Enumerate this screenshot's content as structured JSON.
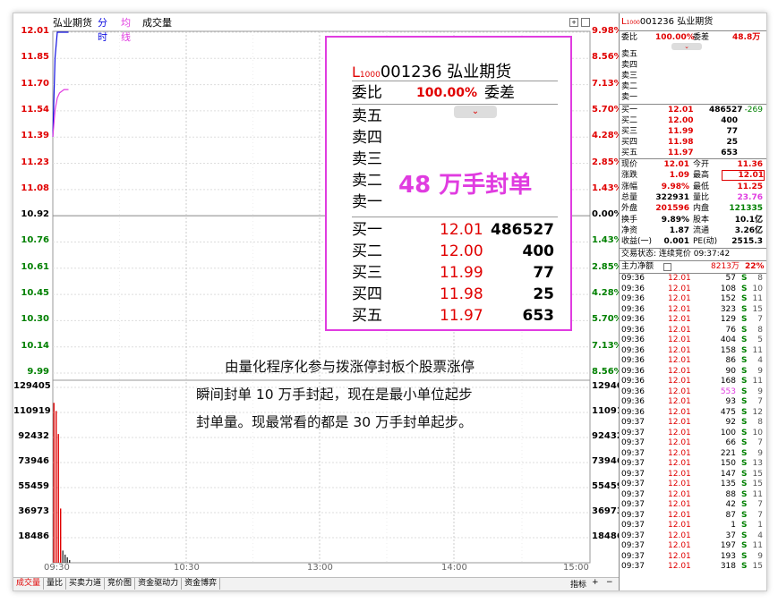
{
  "chart": {
    "stock_name": "弘业期货",
    "tab_intraday": "分时",
    "tab_avg": "均线",
    "tab_volume": "成交量",
    "price_ticks": [
      "12.01",
      "11.85",
      "11.70",
      "11.54",
      "11.39",
      "11.23",
      "11.08",
      "10.92",
      "10.76",
      "10.61",
      "10.45",
      "10.30",
      "10.14",
      "9.99"
    ],
    "pct_ticks": [
      "9.98%",
      "8.56%",
      "7.13%",
      "5.70%",
      "4.28%",
      "2.85%",
      "1.43%",
      "0.00%",
      "1.43%",
      "2.85%",
      "4.28%",
      "5.70%",
      "7.13%",
      "8.56%"
    ],
    "vol_ticks": [
      "129405",
      "110919",
      "92432",
      "73946",
      "55459",
      "36973",
      "18486"
    ],
    "time_ticks": [
      "09:30",
      "10:30",
      "13:00",
      "14:00",
      "15:00"
    ],
    "colors": {
      "up": "#e00000",
      "down": "#008000",
      "price_line": "#1010e0",
      "avg_line": "#e03ce0"
    }
  },
  "chart_data": {
    "type": "line",
    "x": [
      "09:30",
      "09:31",
      "09:32",
      "09:33",
      "09:34",
      "09:35",
      "09:36",
      "09:37"
    ],
    "series": [
      {
        "name": "分时",
        "values": [
          11.39,
          11.86,
          12.01,
          12.01,
          12.01,
          12.01,
          12.01,
          12.01
        ]
      },
      {
        "name": "均线",
        "values": [
          11.39,
          11.55,
          11.62,
          11.65,
          11.66,
          11.67,
          11.67,
          11.67
        ]
      }
    ],
    "volume": [
      118000,
      112000,
      95000,
      40000,
      9000,
      6000,
      4000,
      2000
    ],
    "ylim": [
      9.99,
      12.01
    ],
    "vol_ylim": [
      0,
      129405
    ]
  },
  "bottom_tabs": [
    "成交量",
    "量比",
    "买卖力道",
    "竞价图",
    "资金驱动力",
    "资金博弈"
  ],
  "bottom_right": {
    "index_label": "指标",
    "plus": "+",
    "minus": "−"
  },
  "quote": {
    "code_prefix": "L",
    "code_sub": "1000",
    "code": "001236",
    "name": "弘业期货",
    "weibi_label": "委比",
    "weibi_value": "100.00%",
    "weicha_label": "委差",
    "weicha_value": "48.8万",
    "sell_labels": [
      "卖五",
      "卖四",
      "卖三",
      "卖二",
      "卖一"
    ],
    "buys": [
      {
        "label": "买一",
        "price": "12.01",
        "vol": "486527",
        "chg": "-269"
      },
      {
        "label": "买二",
        "price": "12.00",
        "vol": "400",
        "chg": ""
      },
      {
        "label": "买三",
        "price": "11.99",
        "vol": "77",
        "chg": ""
      },
      {
        "label": "买四",
        "price": "11.98",
        "vol": "25",
        "chg": ""
      },
      {
        "label": "买五",
        "price": "11.97",
        "vol": "653",
        "chg": ""
      }
    ],
    "stats": [
      {
        "l1": "现价",
        "v1": "12.01",
        "l2": "今开",
        "v2": "11.36"
      },
      {
        "l1": "涨跌",
        "v1": "1.09",
        "l2": "最高",
        "v2": "12.01"
      },
      {
        "l1": "涨幅",
        "v1": "9.98%",
        "l2": "最低",
        "v2": "11.25"
      },
      {
        "l1": "总量",
        "v1": "322931",
        "l2": "量比",
        "v2": "23.76"
      },
      {
        "l1": "外盘",
        "v1": "201596",
        "l2": "内盘",
        "v2": "121335"
      },
      {
        "l1": "换手",
        "v1": "9.89%",
        "l2": "股本",
        "v2": "10.1亿"
      },
      {
        "l1": "净资",
        "v1": "1.87",
        "l2": "流通",
        "v2": "3.26亿"
      },
      {
        "l1": "收益(一)",
        "v1": "0.001",
        "l2": "PE(动)",
        "v2": "2515.3"
      }
    ],
    "trade_status": "交易状态: 连续竞价 09:37:42",
    "main_flow_label": "主力净额",
    "main_flow_value": "8213万",
    "main_flow_pct": "22%",
    "ticks": [
      {
        "t": "09:36",
        "p": "12.01",
        "v": "57",
        "s": "S",
        "n": "8"
      },
      {
        "t": "09:36",
        "p": "12.01",
        "v": "108",
        "s": "S",
        "n": "10"
      },
      {
        "t": "09:36",
        "p": "12.01",
        "v": "152",
        "s": "S",
        "n": "11"
      },
      {
        "t": "09:36",
        "p": "12.01",
        "v": "323",
        "s": "S",
        "n": "15"
      },
      {
        "t": "09:36",
        "p": "12.01",
        "v": "129",
        "s": "S",
        "n": "7"
      },
      {
        "t": "09:36",
        "p": "12.01",
        "v": "76",
        "s": "S",
        "n": "8"
      },
      {
        "t": "09:36",
        "p": "12.01",
        "v": "404",
        "s": "S",
        "n": "5"
      },
      {
        "t": "09:36",
        "p": "12.01",
        "v": "158",
        "s": "S",
        "n": "11"
      },
      {
        "t": "09:36",
        "p": "12.01",
        "v": "86",
        "s": "S",
        "n": "4"
      },
      {
        "t": "09:36",
        "p": "12.01",
        "v": "90",
        "s": "S",
        "n": "9"
      },
      {
        "t": "09:36",
        "p": "12.01",
        "v": "168",
        "s": "S",
        "n": "11"
      },
      {
        "t": "09:36",
        "p": "12.01",
        "v": "553",
        "s": "S",
        "n": "9",
        "hl": true
      },
      {
        "t": "09:36",
        "p": "12.01",
        "v": "93",
        "s": "S",
        "n": "7"
      },
      {
        "t": "09:36",
        "p": "12.01",
        "v": "475",
        "s": "S",
        "n": "12"
      },
      {
        "t": "09:37",
        "p": "12.01",
        "v": "92",
        "s": "S",
        "n": "8"
      },
      {
        "t": "09:37",
        "p": "12.01",
        "v": "100",
        "s": "S",
        "n": "10"
      },
      {
        "t": "09:37",
        "p": "12.01",
        "v": "66",
        "s": "S",
        "n": "7"
      },
      {
        "t": "09:37",
        "p": "12.01",
        "v": "221",
        "s": "S",
        "n": "9"
      },
      {
        "t": "09:37",
        "p": "12.01",
        "v": "150",
        "s": "S",
        "n": "13"
      },
      {
        "t": "09:37",
        "p": "12.01",
        "v": "147",
        "s": "S",
        "n": "15"
      },
      {
        "t": "09:37",
        "p": "12.01",
        "v": "135",
        "s": "S",
        "n": "15"
      },
      {
        "t": "09:37",
        "p": "12.01",
        "v": "88",
        "s": "S",
        "n": "11"
      },
      {
        "t": "09:37",
        "p": "12.01",
        "v": "42",
        "s": "S",
        "n": "7"
      },
      {
        "t": "09:37",
        "p": "12.01",
        "v": "87",
        "s": "S",
        "n": "7"
      },
      {
        "t": "09:37",
        "p": "12.01",
        "v": "1",
        "s": "S",
        "n": "1"
      },
      {
        "t": "09:37",
        "p": "12.01",
        "v": "37",
        "s": "S",
        "n": "4"
      },
      {
        "t": "09:37",
        "p": "12.01",
        "v": "197",
        "s": "S",
        "n": "11"
      },
      {
        "t": "09:37",
        "p": "12.01",
        "v": "193",
        "s": "S",
        "n": "9"
      },
      {
        "t": "09:37",
        "p": "12.01",
        "v": "318",
        "s": "S",
        "n": "15"
      }
    ]
  },
  "zoom": {
    "weibi_label": "委比",
    "weibi_value": "100.00%",
    "weicha_label": "委差",
    "sell_labels": [
      "卖五",
      "卖四",
      "卖三",
      "卖二",
      "卖一"
    ],
    "callout": "48 万手封单"
  },
  "note": {
    "line1": "由量化程序化参与拨涨停封板个股票涨停",
    "line2": "瞬间封单 10 万手封起，现在是最小单位起步",
    "line3": "封单量。现最常看的都是 30 万手封单起步。"
  }
}
